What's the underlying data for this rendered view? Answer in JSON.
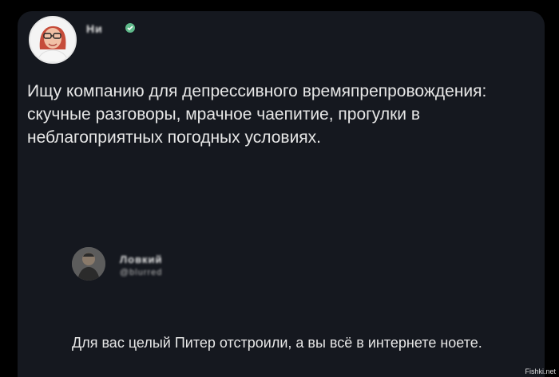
{
  "post": {
    "author_name": "Ни",
    "text": "Ищу компанию для депрессивного времяпрепровождения: скучные разговоры, мрачное чаепитие, прогулки в неблагоприятных погодных условиях."
  },
  "reply": {
    "author_name": "Ловкий",
    "handle": "@blurred",
    "text": "Для вас целый Питер отстроили, а вы всё в интернете ноете."
  },
  "watermark": "Fishki.net",
  "colors": {
    "background": "#000000",
    "card": "#15181f",
    "text": "#e7e7e7"
  }
}
